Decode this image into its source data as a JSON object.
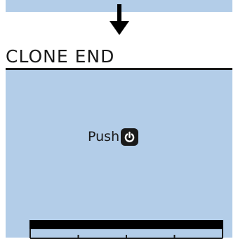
{
  "screen": {
    "title": "CLONE END",
    "prompt_label": "Push",
    "prompt_key_icon": "power-icon",
    "progress": 1.0,
    "scale_divisions": 4
  },
  "colors": {
    "lcd_background": "#b3cde8",
    "text": "#1a1a1a",
    "progress_fill": "#000000"
  }
}
